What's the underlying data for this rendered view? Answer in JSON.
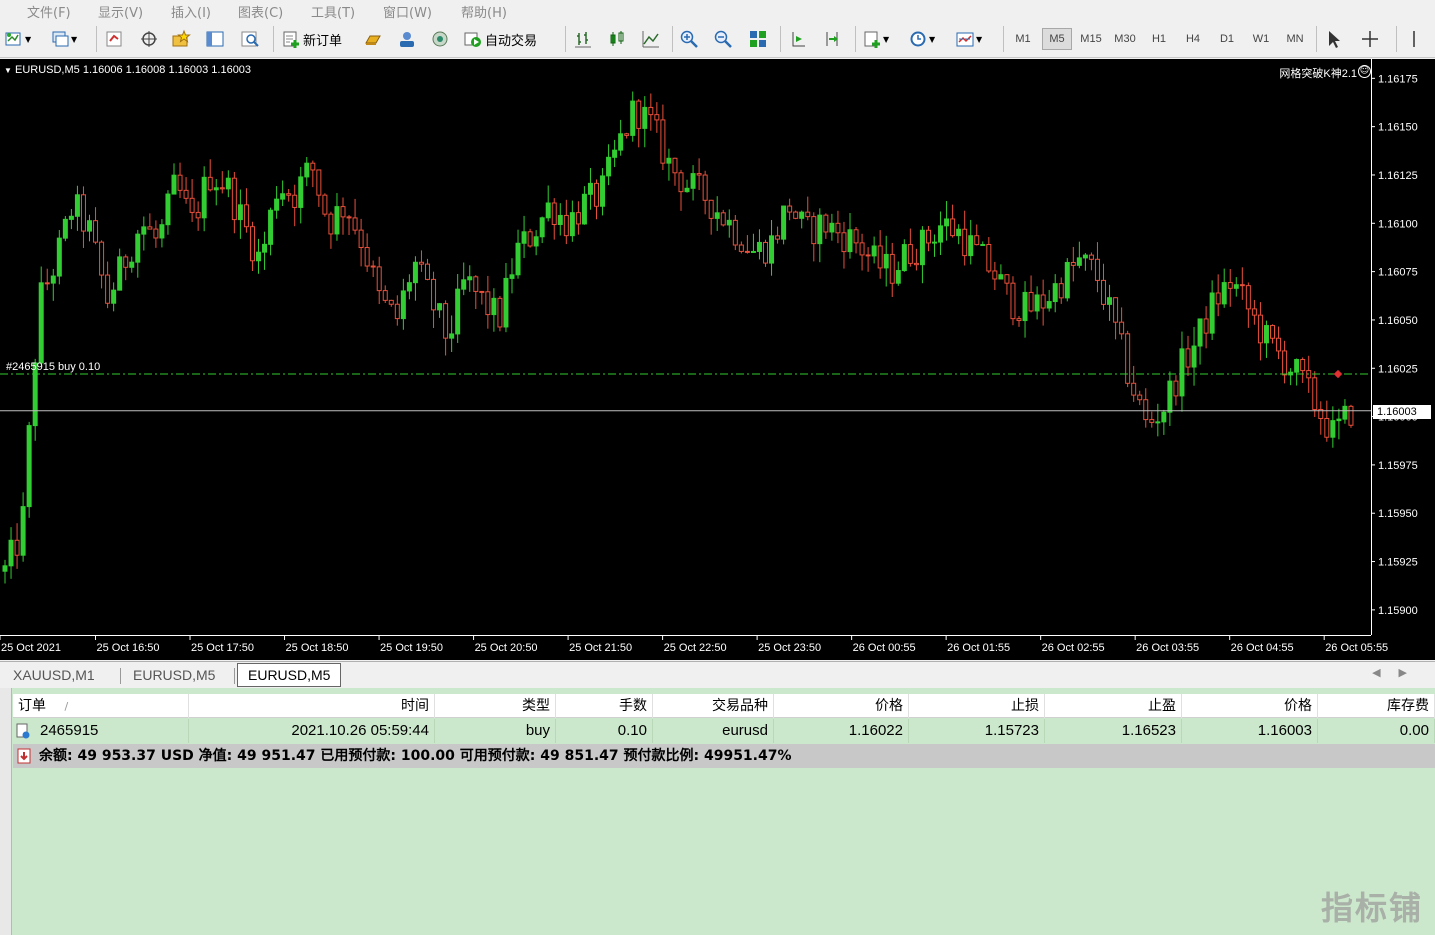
{
  "menu": [
    "文件(F)",
    "显示(V)",
    "插入(I)",
    "图表(C)",
    "工具(T)",
    "窗口(W)",
    "帮助(H)"
  ],
  "toolbar": {
    "new_order_label": "新订单",
    "auto_trade_label": "自动交易",
    "timeframes": [
      "M1",
      "M5",
      "M15",
      "M30",
      "H1",
      "H4",
      "D1",
      "W1",
      "MN"
    ],
    "active_timeframe": "M5"
  },
  "chart": {
    "title": "EURUSD,M5  1.16006 1.16008 1.16003 1.16003",
    "ea_name": "网格突破K神2.1",
    "ea_icon": "☺",
    "order_label": "#2465915 buy 0.10",
    "current_price": "1.16003",
    "bull_color": "#32cd32",
    "bear_color": "#e8503c",
    "order_line_color": "#32cd32",
    "price_line_color": "#c0c0c0"
  },
  "chart_data": {
    "type": "candlestick",
    "symbol": "EURUSD",
    "timeframe": "M5",
    "ylim": [
      1.15887,
      1.16185
    ],
    "y_ticks": [
      "1.16175",
      "1.16150",
      "1.16125",
      "1.16100",
      "1.16075",
      "1.16050",
      "1.16025",
      "1.16000",
      "1.15975",
      "1.15950",
      "1.15925",
      "1.15900"
    ],
    "x_ticks": [
      "25 Oct 2021",
      "25 Oct 16:50",
      "25 Oct 17:50",
      "25 Oct 18:50",
      "25 Oct 19:50",
      "25 Oct 20:50",
      "25 Oct 21:50",
      "25 Oct 22:50",
      "25 Oct 23:50",
      "26 Oct 00:55",
      "26 Oct 01:55",
      "26 Oct 02:55",
      "26 Oct 03:55",
      "26 Oct 04:55",
      "26 Oct 05:55"
    ],
    "order_price": 1.16022,
    "bid_price": 1.16003,
    "close_path": [
      1.1592,
      1.1594,
      1.1606,
      1.1608,
      1.1611,
      1.16095,
      1.1606,
      1.1608,
      1.161,
      1.1609,
      1.1612,
      1.161,
      1.16125,
      1.1612,
      1.161,
      1.1608,
      1.1612,
      1.16115,
      1.1613,
      1.161,
      1.1611,
      1.1609,
      1.1606,
      1.1605,
      1.1608,
      1.1606,
      1.1604,
      1.1607,
      1.1606,
      1.1605,
      1.16085,
      1.16095,
      1.1611,
      1.161,
      1.1611,
      1.16115,
      1.1614,
      1.1616,
      1.1615,
      1.1613,
      1.1612,
      1.16115,
      1.16105,
      1.16095,
      1.16085,
      1.1609,
      1.1611,
      1.16095,
      1.161,
      1.16095,
      1.1609,
      1.1608,
      1.16075,
      1.16085,
      1.1609,
      1.161,
      1.16095,
      1.16085,
      1.16075,
      1.1606,
      1.16055,
      1.1606,
      1.1607,
      1.1608,
      1.16075,
      1.1605,
      1.1602,
      1.15995,
      1.16005,
      1.16025,
      1.1604,
      1.1606,
      1.1607,
      1.16055,
      1.1604,
      1.1603,
      1.1602,
      1.16005,
      1.1599,
      1.16003
    ]
  },
  "tabs": [
    "XAUUSD,M1",
    "EURUSD,M5",
    "EURUSD,M5"
  ],
  "active_tab": 2,
  "terminal": {
    "headers": [
      "订单",
      "时间",
      "类型",
      "手数",
      "交易品种",
      "价格",
      "止损",
      "止盈",
      "价格",
      "库存费"
    ],
    "sort_indicator": "/",
    "row": {
      "order": "2465915",
      "time": "2021.10.26 05:59:44",
      "type": "buy",
      "lots": "0.10",
      "symbol": "eurusd",
      "open_price": "1.16022",
      "sl": "1.15723",
      "tp": "1.16523",
      "price": "1.16003",
      "swap": "0.00"
    },
    "balance_text": "余额: 49 953.37 USD  净值: 49 951.47  已用预付款: 100.00  可用预付款: 49 851.47  预付款比例: 49951.47%"
  },
  "watermark": "指标铺"
}
